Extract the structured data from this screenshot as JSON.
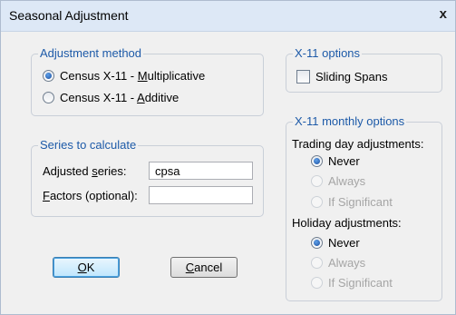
{
  "window": {
    "title": "Seasonal Adjustment",
    "close_glyph": "x"
  },
  "adjustment_method": {
    "legend": "Adjustment method",
    "options": [
      {
        "pre": "Census X-11 - ",
        "mnemonic": "M",
        "post": "ultiplicative",
        "selected": true
      },
      {
        "pre": "Census X-11 - ",
        "mnemonic": "A",
        "post": "dditive",
        "selected": false
      }
    ]
  },
  "x11_options": {
    "legend": "X-11 options",
    "sliding_spans": {
      "label": "Sliding Spans",
      "checked": false
    }
  },
  "series": {
    "legend": "Series to calculate",
    "adjusted": {
      "pre": "Adjusted ",
      "mnemonic": "s",
      "post": "eries:",
      "value": "cpsa"
    },
    "factors": {
      "pre": "",
      "mnemonic": "F",
      "post": "actors (optional):",
      "value": ""
    }
  },
  "monthly": {
    "legend": "X-11 monthly options",
    "trading_label": "Trading day adjustments:",
    "trading_options": [
      {
        "label": "Never",
        "selected": true,
        "enabled": true
      },
      {
        "label": "Always",
        "selected": false,
        "enabled": false
      },
      {
        "label": "If Significant",
        "selected": false,
        "enabled": false
      }
    ],
    "holiday_label": "Holiday adjustments:",
    "holiday_options": [
      {
        "label": "Never",
        "selected": true,
        "enabled": true
      },
      {
        "label": "Always",
        "selected": false,
        "enabled": false
      },
      {
        "label": "If Significant",
        "selected": false,
        "enabled": false
      }
    ]
  },
  "buttons": {
    "ok": {
      "mnemonic": "O",
      "post": "K"
    },
    "cancel": {
      "mnemonic": "C",
      "post": "ancel"
    }
  }
}
